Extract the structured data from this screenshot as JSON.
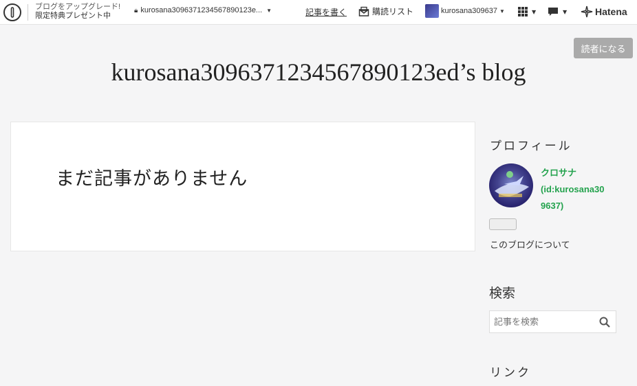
{
  "topbar": {
    "promo_line1": "ブログをアップグレード!",
    "promo_line2": "限定特典プレゼント中",
    "blog_selector": "kurosana3096371234567890123e...",
    "write": "記事を書く",
    "reading_list": "購読リスト",
    "username": "kurosana309637",
    "hatena": "Hatena"
  },
  "subscribe_label": "読者になる",
  "blog_title": "kurosana30963712345678901 23ed’s blog",
  "main": {
    "no_entries": "まだ記事がありません"
  },
  "sidebar": {
    "profile_heading": "プロフィール",
    "profile_name": "クロサナ",
    "profile_id_line1": "(id:kurosana30",
    "profile_id_line2": "9637)",
    "about": "このブログについて",
    "search_heading": "検索",
    "search_placeholder": "記事を検索",
    "link_heading": "リンク"
  },
  "colors": {
    "accent_green": "#23a24d",
    "subscribe_bg": "#aaaaaa"
  },
  "icons": [
    "hatena-blog-logo-icon",
    "lock-icon",
    "caret-icon",
    "reading-list-icon",
    "apps-grid-icon",
    "chat-icon",
    "hatena-logo-icon",
    "search-icon"
  ]
}
